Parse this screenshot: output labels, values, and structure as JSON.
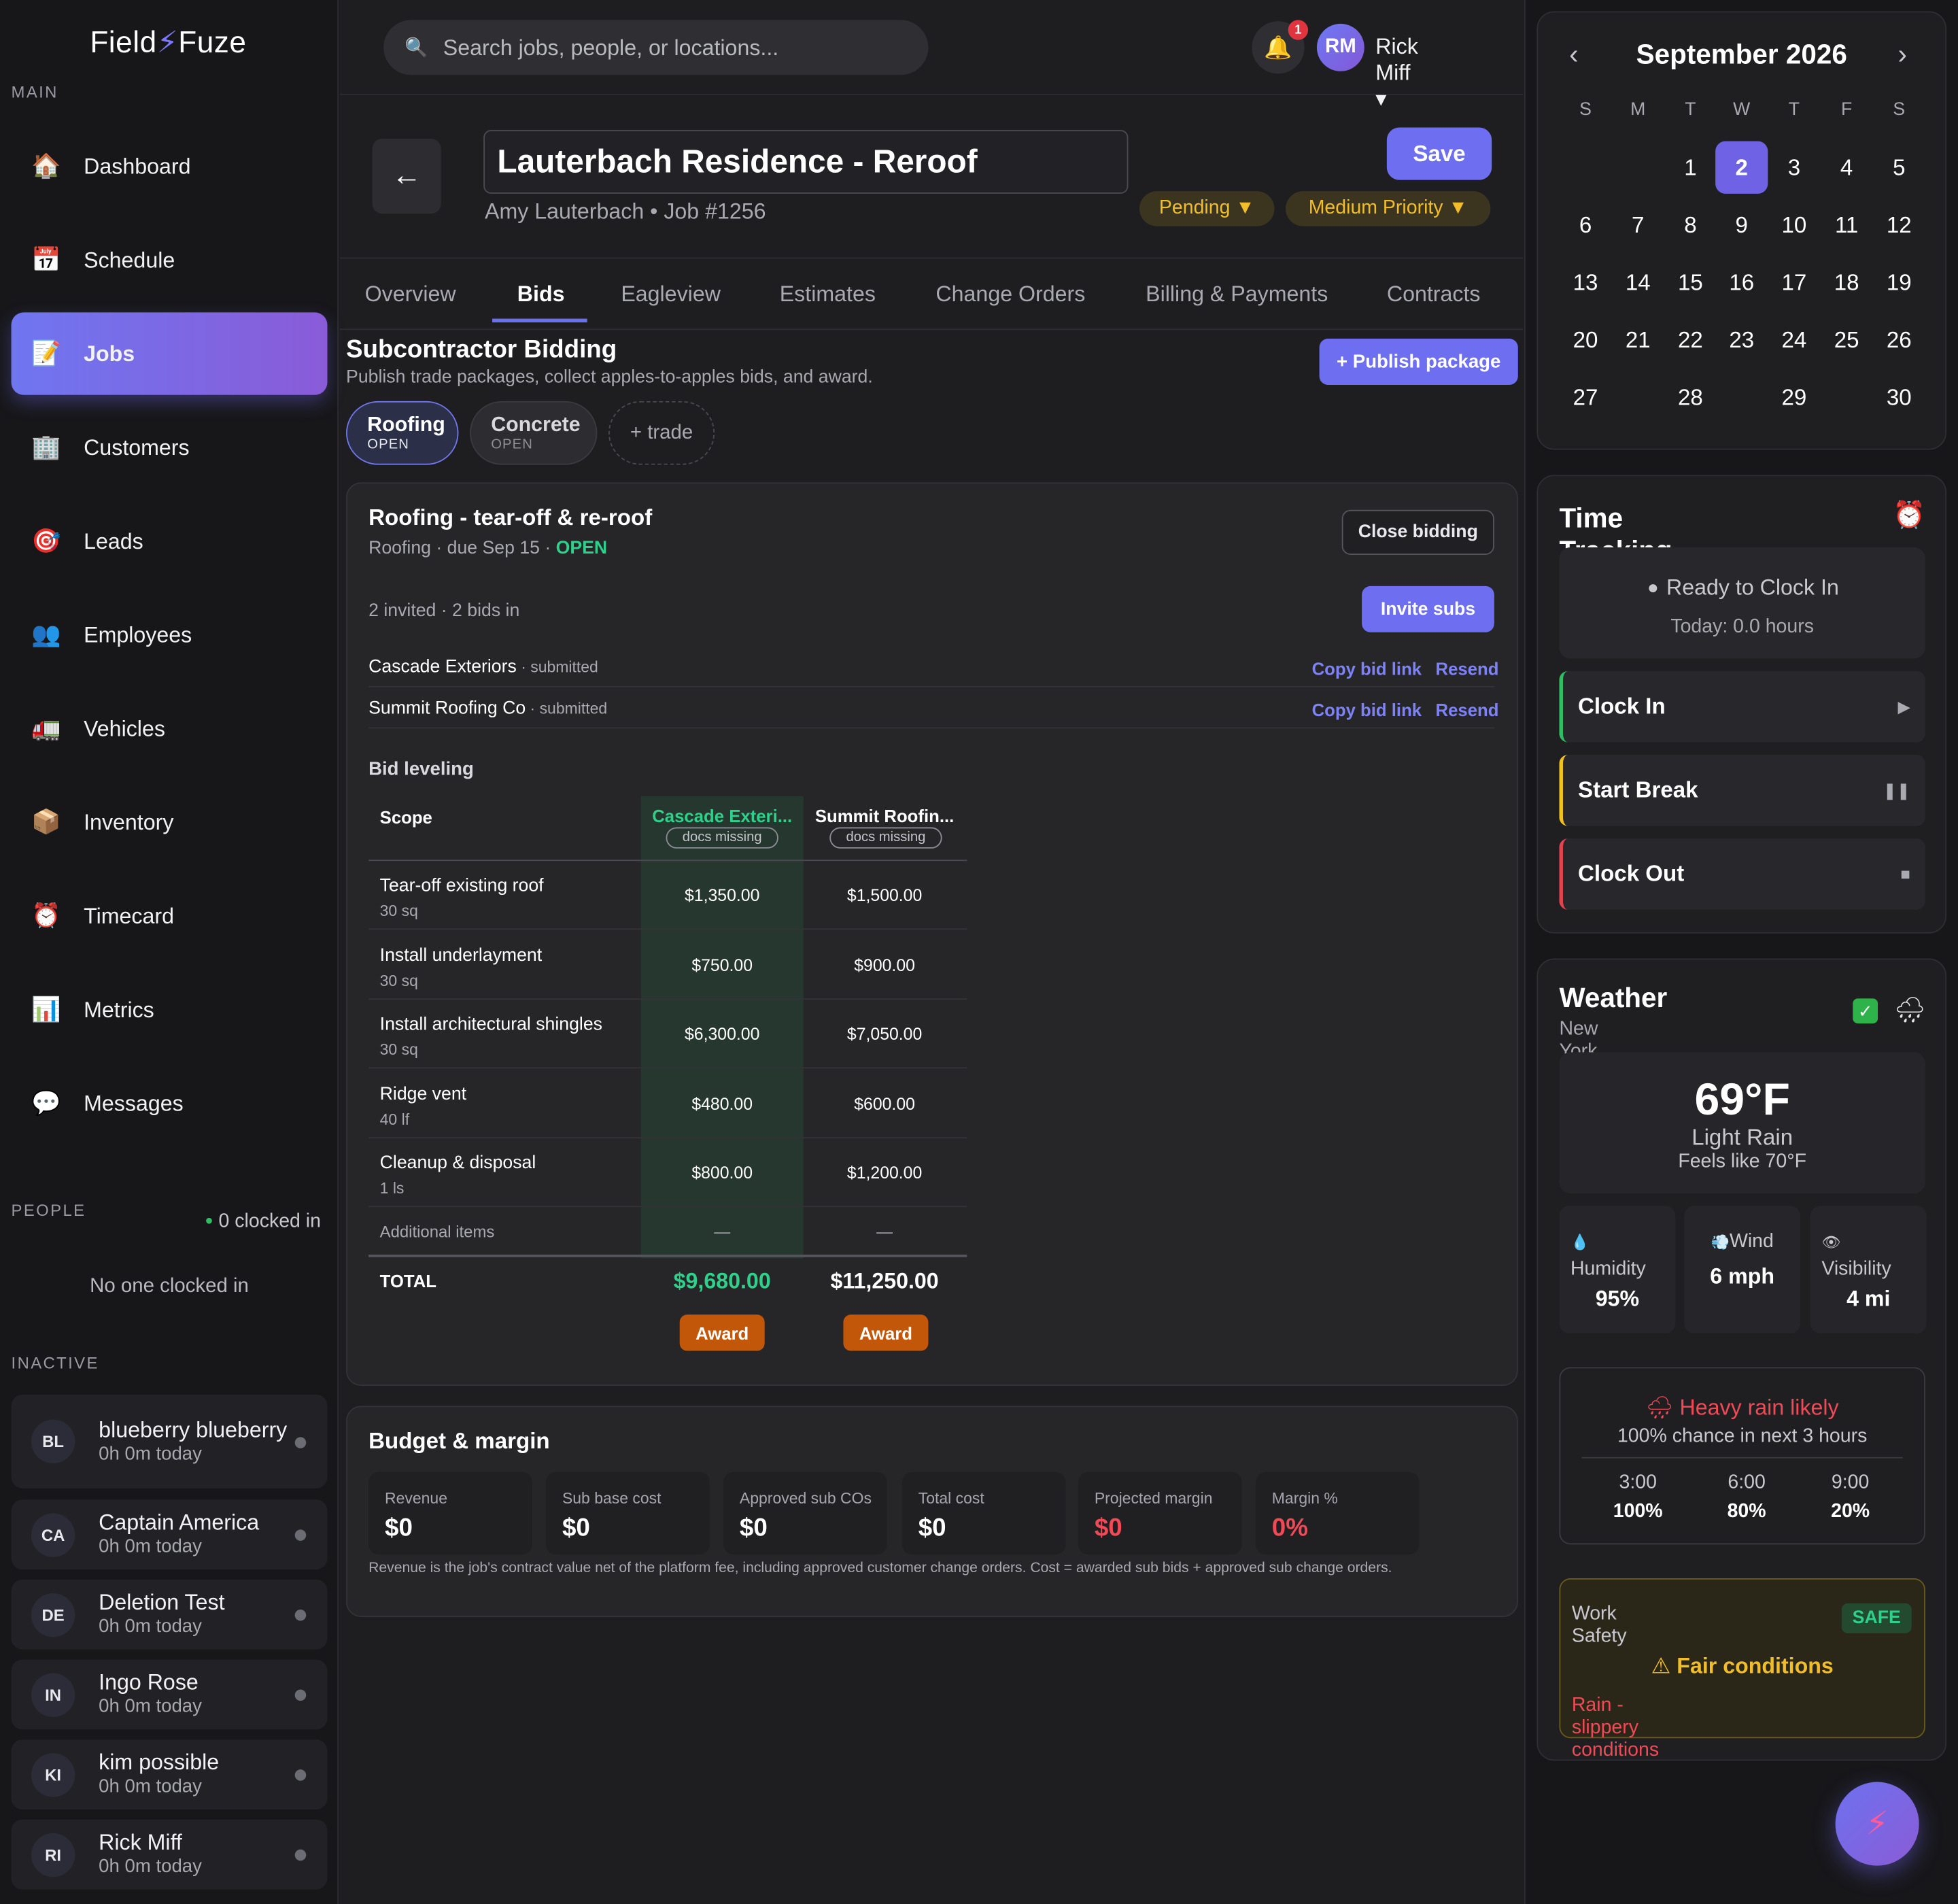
{
  "app": {
    "logo_left": "Field",
    "logo_right": "Fuze"
  },
  "sidebar": {
    "main_label": "MAIN",
    "nav": [
      {
        "label": "Dashboard",
        "icon": "🏠",
        "icon_name": "house-icon"
      },
      {
        "label": "Schedule",
        "icon": "📅",
        "icon_name": "calendar-icon"
      },
      {
        "label": "Jobs",
        "icon": "📝",
        "icon_name": "memo-icon",
        "active": true
      },
      {
        "label": "Customers",
        "icon": "🏢",
        "icon_name": "building-icon"
      },
      {
        "label": "Leads",
        "icon": "🎯",
        "icon_name": "target-icon"
      },
      {
        "label": "Employees",
        "icon": "👥",
        "icon_name": "people-icon"
      },
      {
        "label": "Vehicles",
        "icon": "🚛",
        "icon_name": "truck-icon"
      },
      {
        "label": "Inventory",
        "icon": "📦",
        "icon_name": "box-icon"
      },
      {
        "label": "Timecard",
        "icon": "⏰",
        "icon_name": "alarm-clock-icon"
      },
      {
        "label": "Metrics",
        "icon": "📊",
        "icon_name": "bar-chart-icon"
      },
      {
        "label": "Messages",
        "icon": "💬",
        "icon_name": "speech-bubble-icon"
      }
    ],
    "people_label": "PEOPLE",
    "clocked_in": "0 clocked in",
    "no_one": "No one clocked in",
    "inactive_label": "INACTIVE",
    "inactive": [
      {
        "initials": "BL",
        "name": "blueberry blueberry",
        "today": "0h 0m today"
      },
      {
        "initials": "CA",
        "name": "Captain America",
        "today": "0h 0m today"
      },
      {
        "initials": "DE",
        "name": "Deletion Test",
        "today": "0h 0m today"
      },
      {
        "initials": "IN",
        "name": "Ingo Rose",
        "today": "0h 0m today"
      },
      {
        "initials": "KI",
        "name": "kim possible",
        "today": "0h 0m today"
      },
      {
        "initials": "RI",
        "name": "Rick Miff",
        "today": "0h 0m today"
      }
    ]
  },
  "header": {
    "search_placeholder": "Search jobs, people, or locations...",
    "notifications": "1",
    "user_initials": "RM",
    "user_name": "Rick Miff ▾"
  },
  "job": {
    "title": "Lauterbach Residence - Reroof",
    "subtitle": "Amy Lauterbach • Job #1256",
    "save": "Save",
    "status": "Pending ▼",
    "priority": "Medium Priority ▼",
    "tabs": [
      "Overview",
      "Bids",
      "Eagleview",
      "Estimates",
      "Change Orders",
      "Billing & Payments",
      "Contracts"
    ],
    "active_tab": "Bids"
  },
  "bidding": {
    "title": "Subcontractor Bidding",
    "desc": "Publish trade packages, collect apples-to-apples bids, and award.",
    "publish": "+ Publish package",
    "trades": [
      {
        "name": "Roofing",
        "status": "OPEN",
        "active": true
      },
      {
        "name": "Concrete",
        "status": "OPEN",
        "active": false
      }
    ],
    "add_trade": "+ trade",
    "package": {
      "title": "Roofing - tear-off & re-roof",
      "meta": "Roofing · due Sep 15 · ",
      "status": "OPEN",
      "close": "Close bidding",
      "invited": "2 invited · 2 bids in",
      "invite": "Invite subs",
      "subs": [
        {
          "name": "Cascade Exteriors",
          "status": " · submitted",
          "copy": "Copy bid link",
          "resend": "Resend"
        },
        {
          "name": "Summit Roofing Co",
          "status": " · submitted",
          "copy": "Copy bid link",
          "resend": "Resend"
        }
      ],
      "leveling_title": "Bid leveling",
      "scope_header": "Scope",
      "bidders": [
        {
          "name": "Cascade Exteri...",
          "docs": "docs missing"
        },
        {
          "name": "Summit Roofin...",
          "docs": "docs missing"
        }
      ],
      "rows": [
        {
          "scope": "Tear-off existing roof",
          "qty": "30 sq",
          "a": "$1,350.00",
          "b": "$1,500.00"
        },
        {
          "scope": "Install underlayment",
          "qty": "30 sq",
          "a": "$750.00",
          "b": "$900.00"
        },
        {
          "scope": "Install architectural shingles",
          "qty": "30 sq",
          "a": "$6,300.00",
          "b": "$7,050.00"
        },
        {
          "scope": "Ridge vent",
          "qty": "40 lf",
          "a": "$480.00",
          "b": "$600.00"
        },
        {
          "scope": "Cleanup & disposal",
          "qty": "1 ls",
          "a": "$800.00",
          "b": "$1,200.00"
        }
      ],
      "additional": {
        "label": "Additional items",
        "a": "—",
        "b": "—"
      },
      "total_label": "TOTAL",
      "total_a": "$9,680.00",
      "total_b": "$11,250.00",
      "award": "Award"
    }
  },
  "budget": {
    "title": "Budget & margin",
    "metrics": [
      {
        "label": "Revenue",
        "value": "$0"
      },
      {
        "label": "Sub base cost",
        "value": "$0"
      },
      {
        "label": "Approved sub COs",
        "value": "$0"
      },
      {
        "label": "Total cost",
        "value": "$0"
      },
      {
        "label": "Projected margin",
        "value": "$0",
        "negative": true
      },
      {
        "label": "Margin %",
        "value": "0%",
        "negative": true
      }
    ],
    "note": "Revenue is the job's contract value net of the platform fee, including approved customer change orders. Cost = awarded sub bids + approved sub change orders."
  },
  "calendar": {
    "month": "September 2026",
    "prev": "‹",
    "next": "›",
    "dow": [
      "S",
      "M",
      "T",
      "W",
      "T",
      "F",
      "S"
    ],
    "weeks": [
      [
        "",
        "",
        "1",
        "2",
        "3",
        "4",
        "5"
      ],
      [
        "6",
        "7",
        "8",
        "9",
        "10",
        "11",
        "12"
      ],
      [
        "13",
        "14",
        "15",
        "16",
        "17",
        "18",
        "19"
      ],
      [
        "20",
        "21",
        "22",
        "23",
        "24",
        "25",
        "26"
      ],
      [
        "27",
        "28",
        "29",
        "30"
      ]
    ],
    "selected": "2"
  },
  "time_tracking": {
    "title": "Time Tracking",
    "icon": "⏰",
    "status": "Ready to Clock In",
    "today": "Today: 0.0 hours",
    "actions": [
      {
        "label": "Clock In",
        "icon": "▶",
        "color": "#2fbf63"
      },
      {
        "label": "Start Break",
        "icon": "❚❚",
        "color": "#f2c21b"
      },
      {
        "label": "Clock Out",
        "icon": "■",
        "color": "#e1444e"
      }
    ]
  },
  "weather": {
    "title": "Weather",
    "location": "New York, US",
    "temp": "69°F",
    "condition": "Light Rain",
    "feels": "Feels like 70°F",
    "stats": [
      {
        "icon": "💧",
        "label": "Humidity",
        "value": "95%"
      },
      {
        "icon": "💨",
        "label": "Wind",
        "value": "6 mph"
      },
      {
        "icon": "👁",
        "label": "Visibility",
        "value": "4 mi"
      }
    ],
    "alert_title": "Heavy rain likely",
    "alert_sub": "100% chance in next 3 hours",
    "hours": [
      {
        "time": "3:00",
        "chance": "100%"
      },
      {
        "time": "6:00",
        "chance": "80%"
      },
      {
        "time": "9:00",
        "chance": "20%"
      }
    ],
    "safety_label": "Work Safety",
    "safety_badge": "SAFE",
    "safety_status": "Fair conditions",
    "safety_note": "Rain - slippery conditions"
  },
  "colors": {
    "accent": "#6e6ef0",
    "award": "#c25609",
    "open": "#2fd08a",
    "warning": "#f2bd2b",
    "danger": "#ef4a56"
  }
}
